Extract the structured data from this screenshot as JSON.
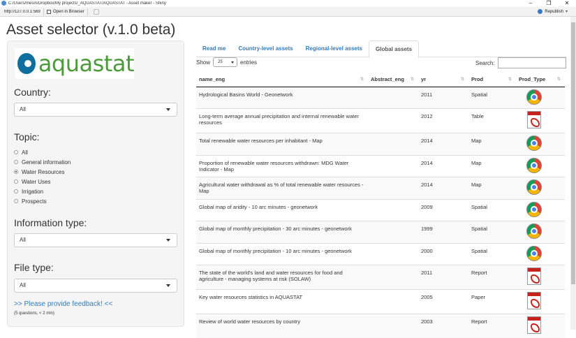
{
  "window": {
    "title": "C:/Users/mesin/Dropbox/My projects/_AQUASTAT/AQUASTAT - Asset maker - Shiny",
    "controls": [
      "–",
      "❐",
      "✕"
    ]
  },
  "toolbar": {
    "url": "http://127.0.0.1:5691",
    "open_in_browser": "Open in Browser",
    "republish": "Republish"
  },
  "app": {
    "title": "Asset selector (v.1.0 beta)"
  },
  "sidebar": {
    "logo_text": "aquastat",
    "country_label": "Country:",
    "country_value": "All",
    "topic_label": "Topic:",
    "topics": [
      {
        "label": "All",
        "selected": false
      },
      {
        "label": "General information",
        "selected": false
      },
      {
        "label": "Water Resources",
        "selected": true
      },
      {
        "label": "Water Uses",
        "selected": false
      },
      {
        "label": "Irrigation",
        "selected": false
      },
      {
        "label": "Prospects",
        "selected": false
      }
    ],
    "info_type_label": "Information type:",
    "info_type_value": "All",
    "file_type_label": "File type:",
    "file_type_value": "All",
    "feedback_link": ">> Please provide feedback! <<",
    "feedback_note": "(5 questions, < 2 min)"
  },
  "tabs": [
    {
      "label": "Read me",
      "active": false
    },
    {
      "label": "Country-level assets",
      "active": false
    },
    {
      "label": "Regional-level assets",
      "active": false
    },
    {
      "label": "Global assets",
      "active": true
    }
  ],
  "table_controls": {
    "show": "Show",
    "page_length": "25",
    "entries": "entries",
    "search_label": "Search:"
  },
  "table": {
    "columns": [
      "name_eng",
      "Abstract_eng",
      "yr",
      "Prod",
      "Prod_Type"
    ],
    "rows": [
      {
        "name": "Hydrological Basins World - Geonetwork",
        "abstract": "",
        "yr": "2011",
        "prod": "Spatial",
        "icon": "chrome-icon"
      },
      {
        "name": "Long-term average annual precipitation and internal renewable water resources",
        "abstract": "",
        "yr": "2012",
        "prod": "Table",
        "icon": "pdf-icon"
      },
      {
        "name": "Total renewable water resources per inhabitant - Map",
        "abstract": "",
        "yr": "2014",
        "prod": "Map",
        "icon": "chrome-icon"
      },
      {
        "name": "Proportion of renewable water resources withdrawn: MDG Water Indicator - Map",
        "abstract": "",
        "yr": "2014",
        "prod": "Map",
        "icon": "chrome-icon"
      },
      {
        "name": "Agricultural water withdrawal as % of total renewable water resources - Map",
        "abstract": "",
        "yr": "2014",
        "prod": "Map",
        "icon": "chrome-icon"
      },
      {
        "name": "Global map of aridity - 10 arc minutes - geonetwork",
        "abstract": "",
        "yr": "2009",
        "prod": "Spatial",
        "icon": "chrome-icon"
      },
      {
        "name": "Global map of monthly precipitation - 30 arc minutes - geonetwork",
        "abstract": "",
        "yr": "1999",
        "prod": "Spatial",
        "icon": "chrome-icon"
      },
      {
        "name": "Global map of monthly precipitation - 10 arc minutes - geonetwork",
        "abstract": "",
        "yr": "2000",
        "prod": "Spatial",
        "icon": "chrome-icon"
      },
      {
        "name": "The state of the world's land and water resources for food and agriculture - managing systems at risk (SOLAW)",
        "abstract": "",
        "yr": "2011",
        "prod": "Report",
        "icon": "pdf-icon"
      },
      {
        "name": "Key water resources statistics in AQUASTAT",
        "abstract": "",
        "yr": "2005",
        "prod": "Paper",
        "icon": "pdf-icon"
      },
      {
        "name": "Review of world water resources by country",
        "abstract": "",
        "yr": "2003",
        "prod": "Report",
        "icon": "pdf-icon"
      }
    ]
  }
}
